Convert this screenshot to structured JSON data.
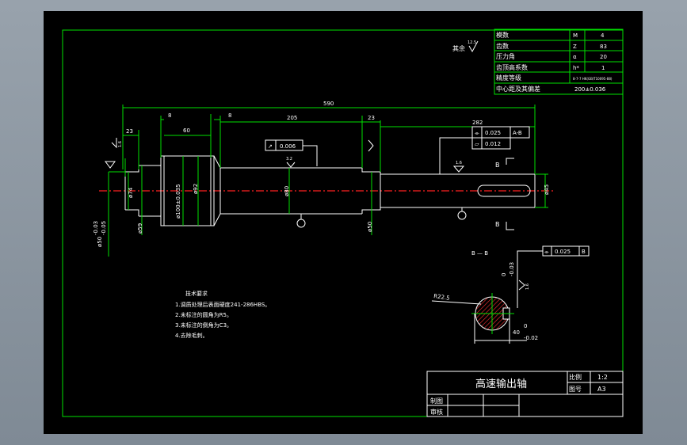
{
  "param_table": {
    "rows": [
      {
        "label": "模数",
        "sym": "M",
        "val": "4"
      },
      {
        "label": "齿数",
        "sym": "Z",
        "val": "83"
      },
      {
        "label": "压力角",
        "sym": "α",
        "val": "20"
      },
      {
        "label": "齿顶高系数",
        "sym": "h*",
        "val": "1"
      },
      {
        "label": "精度等级",
        "sym": "",
        "val": "8-7-7 HK(GB/T10095-88)"
      },
      {
        "label": "中心距及其偏差",
        "sym": "",
        "val": "200±0.036"
      }
    ]
  },
  "roughness_note": {
    "label": "其余",
    "value": "12.5"
  },
  "dimensions": {
    "total": "590",
    "d23a": "23",
    "d8a": "8",
    "d60": "60",
    "d8b": "8",
    "d205": "205",
    "d23b": "23",
    "d282": "282",
    "dia74": "ø74",
    "dia59": "ø59",
    "dia100": "ø100±0.035",
    "dia92": "ø92",
    "dia80": "ø80",
    "dia50": "ø50",
    "dia45": "ø45",
    "dia50tol": "ø50",
    "tol_up": "-0.03",
    "tol_dn": "-0.05",
    "rough16a": "1.6",
    "rough32": "3.2",
    "rough16b": "1.6"
  },
  "tolerance_frames": {
    "runout": {
      "sym": "↗",
      "value": "0.006"
    },
    "sym_a": {
      "sym": "⌯",
      "value": "0.025",
      "datum": "A-B"
    },
    "flat_a": {
      "sym": "▱",
      "value": "0.012"
    },
    "sym_b": {
      "sym": "⌯",
      "value": "0.025",
      "datum": "B"
    }
  },
  "section": {
    "label_b1": "B",
    "label_b2": "B",
    "title": "B — B",
    "r": "R22.5",
    "dim40": "40",
    "dim40_up": "0",
    "dim40_dn": "-0.02",
    "key_up": "0",
    "key_dn": "-0.03",
    "rough": "1.6"
  },
  "tech_req": {
    "title": "技术要求",
    "items": [
      "1.调质处理后表面硬度241-286HBS。",
      "2.未标注的圆角为R5。",
      "3.未标注的倒角为C3。",
      "4.去除毛刺。"
    ]
  },
  "title_block": {
    "name": "高速输出轴",
    "scale_label": "比例",
    "scale_value": "1:2",
    "drawing_label": "图号",
    "drawing_value": "A3",
    "draw_label": "制图",
    "check_label": "审核"
  }
}
